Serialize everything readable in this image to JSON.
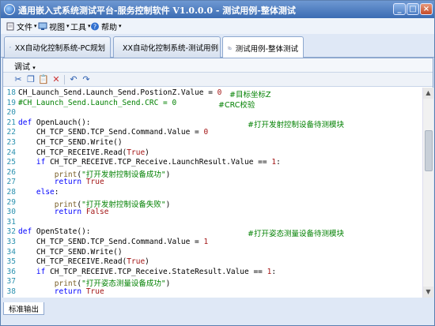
{
  "window": {
    "title": "通用嵌入式系统测试平台-服务控制软件 V1.0.0.0  -  测试用例-整体测试"
  },
  "menubar": {
    "items": [
      {
        "label": "文件",
        "icon": "file-icon"
      },
      {
        "label": "视图",
        "icon": "monitor-icon"
      },
      {
        "label": "工具",
        "icon": ""
      },
      {
        "label": "帮助",
        "icon": "help-icon"
      }
    ]
  },
  "tabs": [
    {
      "label": "XX自动化控制系统-PC规划",
      "icon": "pc-icon"
    },
    {
      "label": "XX自动化控制系统-测试用例",
      "icon": "diagram-icon"
    },
    {
      "label": "测试用例-整体测试",
      "icon": "sync-icon"
    }
  ],
  "sub_menu": {
    "label": "调试"
  },
  "toolbar": {
    "buttons": [
      "cut-icon",
      "copy-icon",
      "paste-icon",
      "delete-icon",
      "undo-icon",
      "redo-icon"
    ]
  },
  "code": {
    "lines": [
      {
        "n": "18",
        "text": "CH_Launch_Send.Launch_Send.PostionZ.Value = 0",
        "comment": "#目标坐标Z",
        "kind": "plain"
      },
      {
        "n": "19",
        "text": "#CH_Launch_Send.Launch_Send.CRC = 0",
        "comment": "#CRC校验",
        "kind": "comment"
      },
      {
        "n": "20",
        "text": "",
        "comment": "",
        "kind": "plain"
      },
      {
        "n": "21",
        "text": "def OpenLauch():",
        "comment": "#打开发射控制设备待测模块",
        "kind": "def"
      },
      {
        "n": "22",
        "text": "    CH_TCP_SEND.TCP_Send.Command.Value = 0",
        "comment": "",
        "kind": "plain"
      },
      {
        "n": "23",
        "text": "    CH_TCP_SEND.Write()",
        "comment": "",
        "kind": "plain"
      },
      {
        "n": "24",
        "text": "    CH_TCP_RECEIVE.Read(True)",
        "comment": "",
        "kind": "plain"
      },
      {
        "n": "25",
        "text": "    if CH_TCP_RECEIVE.TCP_Receive.LaunchResult.Value == 1:",
        "comment": "",
        "kind": "if"
      },
      {
        "n": "26",
        "text": "        print(\"打开发射控制设备成功\")",
        "comment": "",
        "kind": "print"
      },
      {
        "n": "27",
        "text": "        return True",
        "comment": "",
        "kind": "return"
      },
      {
        "n": "28",
        "text": "    else:",
        "comment": "",
        "kind": "else"
      },
      {
        "n": "29",
        "text": "        print(\"打开发射控制设备失败\")",
        "comment": "",
        "kind": "print"
      },
      {
        "n": "30",
        "text": "        return False",
        "comment": "",
        "kind": "return"
      },
      {
        "n": "31",
        "text": "",
        "comment": "",
        "kind": "plain"
      },
      {
        "n": "32",
        "text": "def OpenState():",
        "comment": "#打开姿态测量设备待测模块",
        "kind": "def"
      },
      {
        "n": "33",
        "text": "    CH_TCP_SEND.TCP_Send.Command.Value = 1",
        "comment": "",
        "kind": "plain"
      },
      {
        "n": "34",
        "text": "    CH_TCP_SEND.Write()",
        "comment": "",
        "kind": "plain"
      },
      {
        "n": "35",
        "text": "    CH_TCP_RECEIVE.Read(True)",
        "comment": "",
        "kind": "plain"
      },
      {
        "n": "36",
        "text": "    if CH_TCP_RECEIVE.TCP_Receive.StateResult.Value == 1:",
        "comment": "",
        "kind": "if"
      },
      {
        "n": "37",
        "text": "        print(\"打开姿态测量设备成功\")",
        "comment": "",
        "kind": "print"
      },
      {
        "n": "38",
        "text": "        return True",
        "comment": "",
        "kind": "return"
      }
    ]
  },
  "statusbar": {
    "tab_label": "标准输出"
  }
}
